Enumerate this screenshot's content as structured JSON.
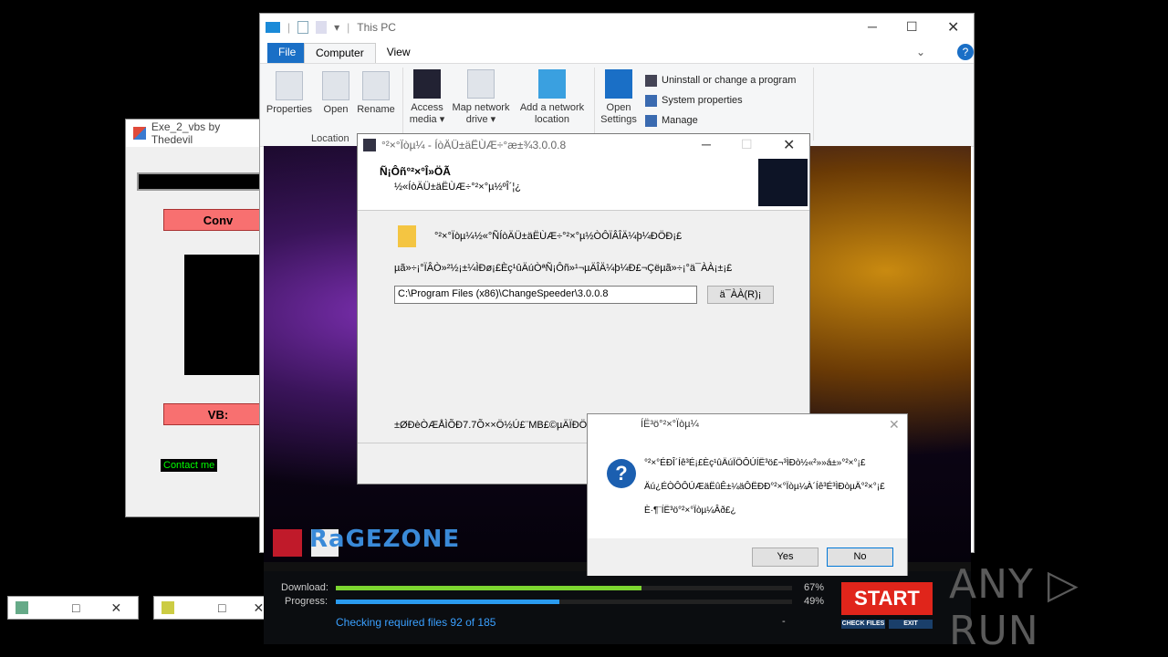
{
  "exe_window": {
    "title": "Exe_2_vbs by Thedevil",
    "convert_label": "Conv",
    "vbs_label": "VB:",
    "contact_label": "Contact me"
  },
  "explorer": {
    "title": "This PC",
    "tabs": [
      "File",
      "Computer",
      "View"
    ],
    "ribbon": {
      "properties": "Properties",
      "open": "Open",
      "rename": "Rename",
      "location_group": "Location",
      "access_media": "Access media ▾",
      "map_drive": "Map network drive ▾",
      "add_location": "Add a network location",
      "open_settings": "Open Settings",
      "uninstall": "Uninstall or change a program",
      "system_props": "System properties",
      "manage": "Manage"
    }
  },
  "installer": {
    "title": "°²×°Ïòµ¼ - ÍòÄÜ±äËÙÆ÷°æ±¾3.0.0.8",
    "header_title": "Ñ¡Ôñ°²×°Î»ÖÃ",
    "header_sub": "½«ÍòÄÜ±äËÙÆ÷°²×°µ½ºÎ´¦¿",
    "line1": "°²×°Ïòµ¼½«°ÑÍòÄÜ±äËÙÆ÷°²×°µ½ÒÔÏÂÎÄ¼þ¼ÐÖÐ¡£",
    "line2": "µã»÷¡°ÏÂÒ»²½¡±¼ÌÐø¡£Èç¹ûÄúÒªÑ¡Ôñ»¹¬µÄÎÄ¼þ¼Ð£¬Çëµã»÷¡°ä¯ÀÀ¡±¡£",
    "path_value": "C:\\Program Files (x86)\\ChangeSpeeder\\3.0.0.8",
    "browse_label": "ä¯ÀÀ(R)¡­",
    "space_text": "±ØÐèÒÆÅÌÕÐ7.7Õ××Ö½Ú£¨MB£©µÄÏÐÖÃ"
  },
  "msgbox": {
    "title": "ÍË³ö°²×°Ïòµ¼",
    "line1": "°²×°ÉÐÎ´Íê³É¡£Èç¹ûÄúÏÖÔÚÍË³ö£¬³ÌÐò½«²»»á±»°²×°¡£",
    "line2": "Äú¿ÉÒÔÔÚÆäËûÊ±¼äÔËÐÐ°²×°Ïòµ¼À´Íê³É³ÌÐòµÄ°²×°¡£",
    "line3": "È·¶¨ÍË³ö°²×°Ïòµ¼Âð£¿",
    "yes": "Yes",
    "no": "No"
  },
  "game": {
    "logo": "RaGEZONE",
    "download_label": "Download:",
    "progress_label": "Progress:",
    "download_pct": "67%",
    "progress_pct": "49%",
    "download_value": 0.67,
    "progress_value": 0.49,
    "status": "Checking required files 92 of 185",
    "dash": "-",
    "start": "START",
    "check_files": "CHECK FILES",
    "exit": "EXIT"
  },
  "watermark": "ANY ▷ RUN",
  "colors": {
    "file_tab": "#1a6fc6",
    "start_button": "#e0251b",
    "download_bar": "#7cd630",
    "progress_bar": "#2a9bef"
  }
}
